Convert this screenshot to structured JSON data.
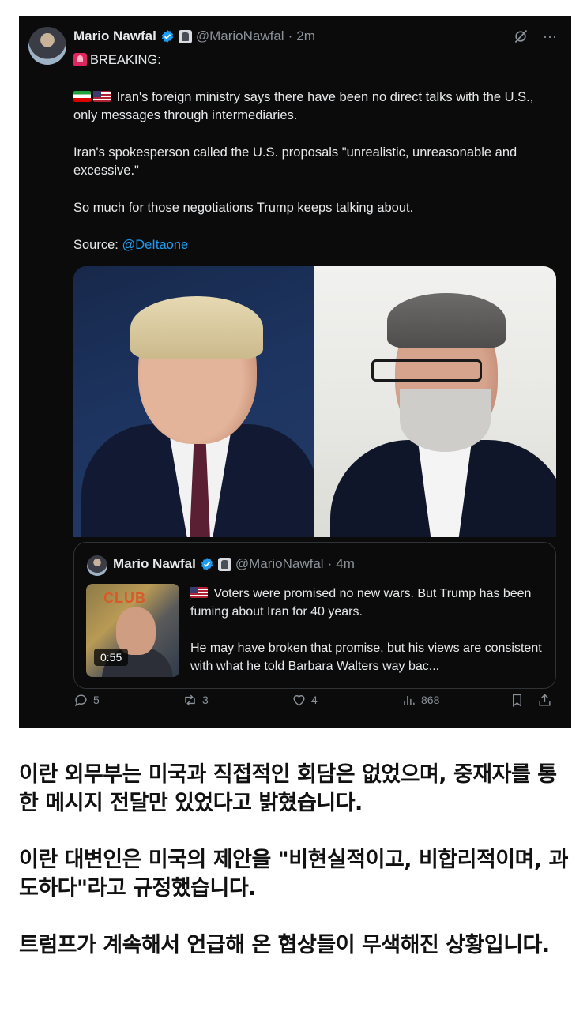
{
  "tweet": {
    "author_name": "Mario Nawfal",
    "handle": "@MarioNawfal",
    "time": "2m",
    "breaking": "BREAKING:",
    "para1": "Iran's foreign ministry says there have been no direct talks with the U.S., only messages through intermediaries.",
    "para2": "Iran's spokesperson called the U.S. proposals \"unrealistic, unreasonable and excessive.\"",
    "para3": "So much for those negotiations Trump keeps talking about.",
    "source_label": "Source:",
    "source_mention": "@DeItaone"
  },
  "quote": {
    "author_name": "Mario Nawfal",
    "handle": "@MarioNawfal",
    "time": "4m",
    "thumb_text": "CLUB",
    "duration": "0:55",
    "para1": "Voters were promised no new wars. But Trump has been fuming about Iran for 40 years.",
    "para2": "He may have broken that promise, but his views are consistent with what he told Barbara Walters way bac..."
  },
  "actions": {
    "replies": "5",
    "reposts": "3",
    "likes": "4",
    "views": "868"
  },
  "translation": {
    "para1": "이란 외무부는 미국과 직접적인 회담은 없었으며, 중재자를 통한 메시지 전달만 있었다고 밝혔습니다.",
    "para2": "이란 대변인은 미국의 제안을 \"비현실적이고, 비합리적이며, 과도하다\"라고 규정했습니다.",
    "para3": "트럼프가 계속해서 언급해 온 협상들이 무색해진 상황입니다."
  },
  "colors": {
    "card_bg": "#0b0b0c",
    "text": "#e7e9ea",
    "muted": "#8b9299",
    "link": "#1d9bf0",
    "verified": "#1d9bf0"
  },
  "icons": [
    "verified-badge-icon",
    "affiliate-badge-icon",
    "grok-icon",
    "more-icon",
    "siren-emoji-icon",
    "iran-flag-icon",
    "us-flag-icon",
    "reply-icon",
    "repost-icon",
    "like-icon",
    "views-icon",
    "bookmark-icon",
    "share-icon"
  ]
}
